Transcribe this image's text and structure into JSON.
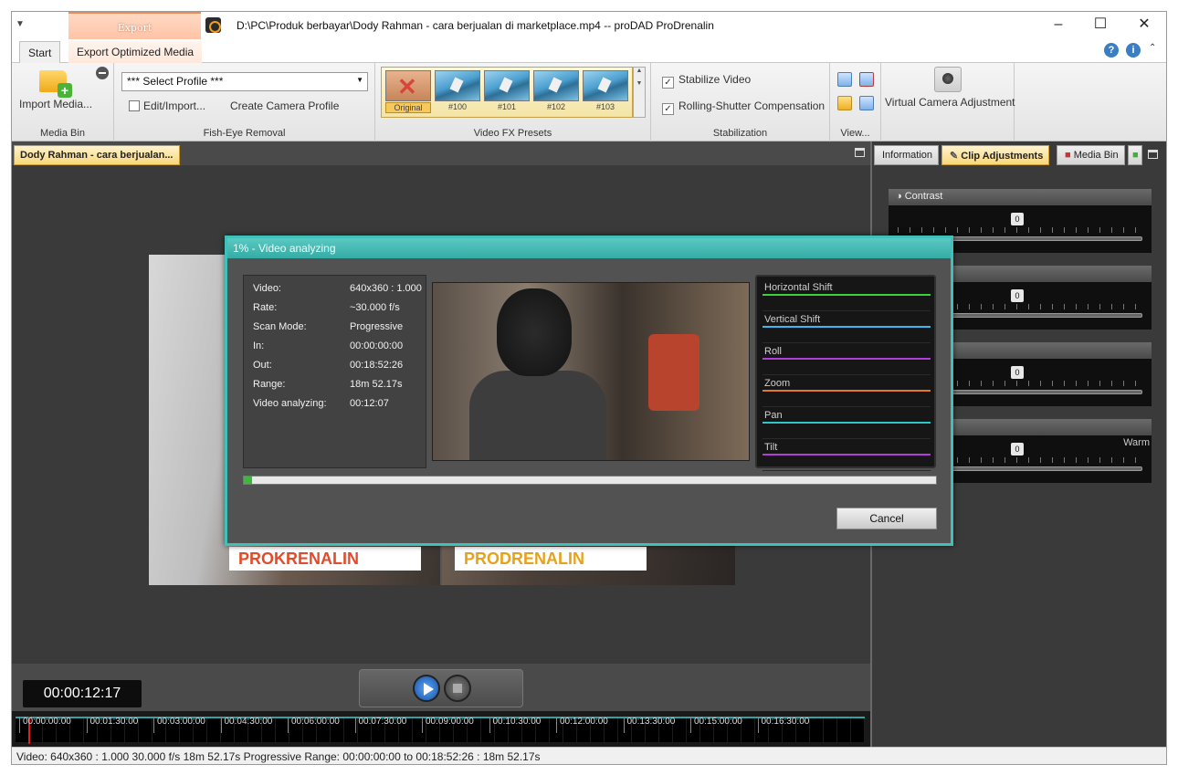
{
  "window": {
    "title": "D:\\PC\\Produk berbayar\\Dody Rahman - cara berjualan di marketplace.mp4 -- proDAD ProDrenalin",
    "context_group": "Export",
    "minimize": "–",
    "maximize": "☐",
    "close": "✕"
  },
  "ribbon_tabs": {
    "start": "Start",
    "export_optimized": "Export Optimized Media"
  },
  "ribbon": {
    "media_bin": {
      "import_label": "Import Media...",
      "group_label": "Media Bin"
    },
    "fisheye": {
      "profile_value": "*** Select Profile ***",
      "edit_import": "Edit/Import...",
      "create_camera": "Create Camera Profile",
      "group_label": "Fish-Eye Removal"
    },
    "presets": {
      "items": [
        "Original",
        "#100",
        "#101",
        "#102",
        "#103"
      ],
      "group_label": "Video FX Presets"
    },
    "stabilization": {
      "stabilize": "Stabilize Video",
      "rolling_shutter": "Rolling-Shutter Compensation",
      "group_label": "Stabilization"
    },
    "view": {
      "group_label": "View..."
    },
    "vca": {
      "label": "Virtual Camera Adjustment"
    }
  },
  "doc_tab": "Dody  Rahman  -  cara  berjualan...",
  "right_tabs": {
    "information": "Information",
    "clip_adjustments": "Clip Adjustments",
    "media_bin": "Media Bin"
  },
  "adjustments": [
    {
      "header": "Contrast",
      "value": "0",
      "right_label": ""
    },
    {
      "header": "",
      "value": "0",
      "right_label": ""
    },
    {
      "header": "",
      "value": "0",
      "right_label": ""
    },
    {
      "header": "",
      "value": "0",
      "right_label": "Warm"
    }
  ],
  "timecode": "00:00:12:17",
  "timeline_labels": [
    "00:00:00:00",
    "00:01:30:00",
    "00:03:00:00",
    "00:04:30:00",
    "00:06:00:00",
    "00:07:30:00",
    "00:09:00:00",
    "00:10:30:00",
    "00:12:00:00",
    "00:13:30:00",
    "00:15:00:00",
    "00:16:30:00"
  ],
  "status": "Video: 640x360 : 1.000   30.000 f/s   18m 52.17s   Progressive   Range: 00:00:00:00 to 00:18:52:26 : 18m 52.17s",
  "dialog": {
    "title": "1% - Video analyzing",
    "progress": 0.01,
    "info": [
      {
        "label": "Video:",
        "value": "640x360 : 1.000"
      },
      {
        "label": "Rate:",
        "value": "~30.000 f/s"
      },
      {
        "label": "Scan Mode:",
        "value": "Progressive"
      },
      {
        "label": "In:",
        "value": "00:00:00:00"
      },
      {
        "label": "Out:",
        "value": "00:18:52:26"
      },
      {
        "label": "Range:",
        "value": "18m 52.17s"
      },
      {
        "label": "Video analyzing:",
        "value": "00:12:07"
      }
    ],
    "graphs": [
      {
        "label": "Horizontal Shift",
        "color": "#3fcf3f"
      },
      {
        "label": "Vertical Shift",
        "color": "#3fb6f0"
      },
      {
        "label": "Roll",
        "color": "#b03fd8"
      },
      {
        "label": "Zoom",
        "color": "#e07a2a"
      },
      {
        "label": "Pan",
        "color": "#2ec6c6"
      },
      {
        "label": "Tilt",
        "color": "#b03fd8"
      }
    ],
    "cancel": "Cancel"
  },
  "watermarks": [
    "PROKRENALIN",
    "PRODRENALIN"
  ]
}
